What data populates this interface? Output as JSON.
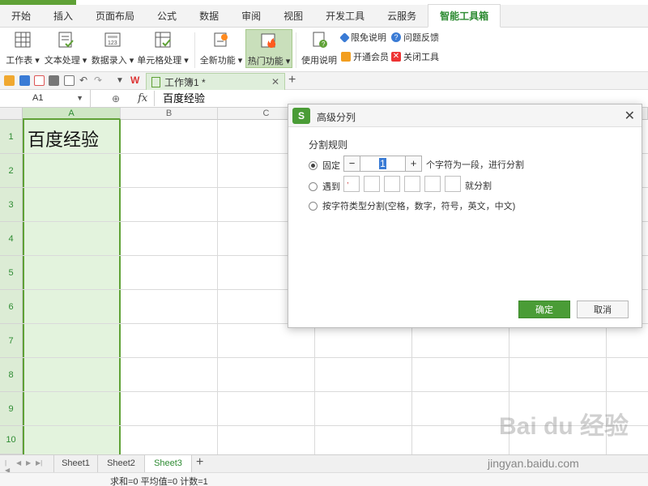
{
  "menu": {
    "tabs": [
      "开始",
      "插入",
      "页面布局",
      "公式",
      "数据",
      "审阅",
      "视图",
      "开发工具",
      "云服务",
      "智能工具箱"
    ],
    "active_index": 9
  },
  "ribbon": {
    "worksheet": "工作表",
    "text_processing": "文本处理",
    "data_entry": "数据录入",
    "cell_processing": "单元格处理",
    "new_features": "全新功能",
    "hot_features": "热门功能",
    "usage_guide": "使用说明",
    "free_notice": "限免说明",
    "feedback": "问题反馈",
    "membership": "开通会员",
    "close_tool": "关闭工具"
  },
  "document_tab": {
    "title": "工作簿1 *"
  },
  "formula_bar": {
    "cell_ref": "A1",
    "fx": "fx",
    "value": "百度经验"
  },
  "grid": {
    "columns": [
      "A",
      "B",
      "C"
    ],
    "rows": [
      "1",
      "2",
      "3",
      "4",
      "5",
      "6",
      "7",
      "8",
      "9",
      "10"
    ],
    "cell_a1": "百度经验"
  },
  "sheets": {
    "tabs": [
      "Sheet1",
      "Sheet2",
      "Sheet3"
    ],
    "active_index": 2
  },
  "status": {
    "text": "求和=0  平均值=0  计数=1"
  },
  "dialog": {
    "title": "高级分列",
    "logo": "S",
    "section_label": "分割规则",
    "option_fixed": "固定",
    "fixed_value": "1",
    "fixed_suffix": "个字符为一段，进行分割",
    "option_encounter": "遇到",
    "encounter_first_char": ",",
    "encounter_suffix": "就分割",
    "option_char_type": "按字符类型分割(空格，数字，符号，英文，中文)",
    "ok_label": "确定",
    "cancel_label": "取消",
    "colors": {
      "primary": "#4a9c36"
    }
  },
  "watermark": {
    "brand": "Bai du 经验",
    "url": "jingyan.baidu.com"
  }
}
